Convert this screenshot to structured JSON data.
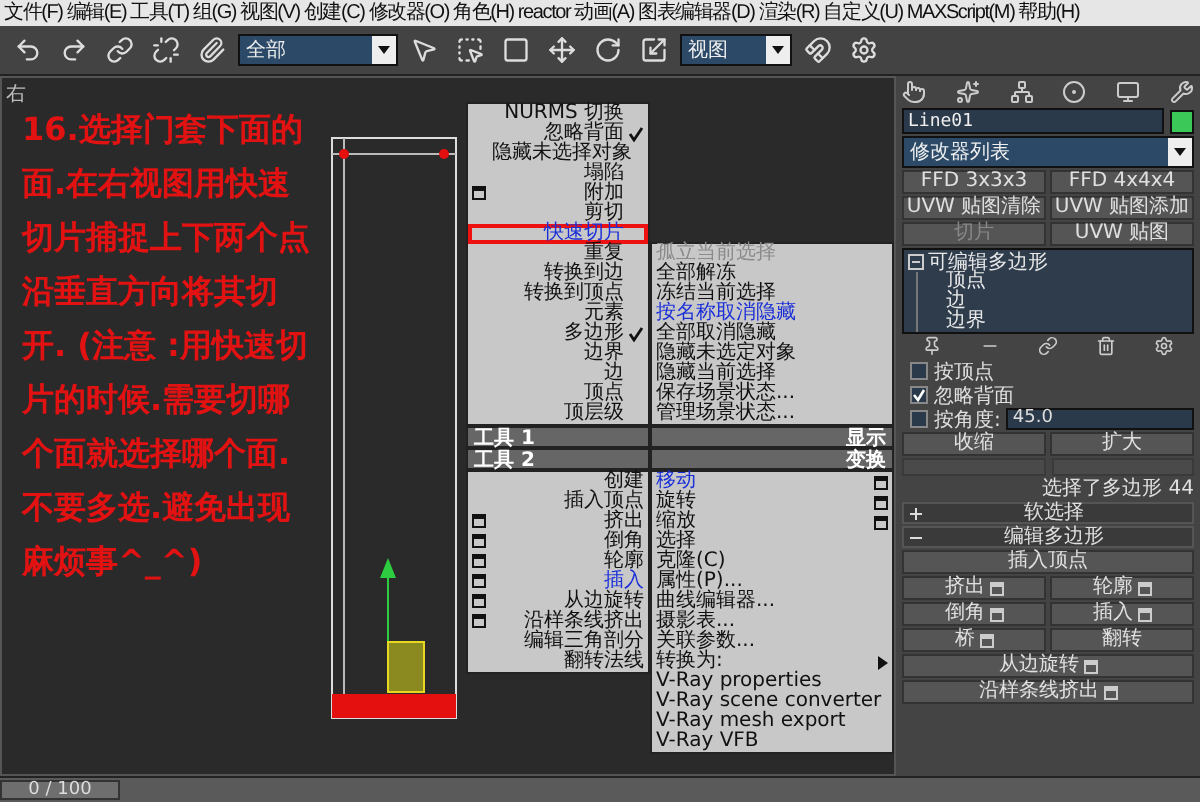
{
  "menu_bar": [
    "文件(F)",
    "编辑(E)",
    "工具(T)",
    "组(G)",
    "视图(V)",
    "创建(C)",
    "修改器(O)",
    "角色(H)",
    "reactor",
    "动画(A)",
    "图表编辑器(D)",
    "渲染(R)",
    "自定义(U)",
    "MAXScript(M)",
    "帮助(H)"
  ],
  "toolbar": {
    "selection_filter": "全部",
    "coordinate_system": "视图"
  },
  "viewport": {
    "label": "右",
    "note": "16.选择门套下面的面.在右视图用快速切片捕捉上下两个点沿垂直方向将其切开. (注意 :用快速切片的时候.需要切哪个面就选择哪个面.不要多选.避免出现麻烦事^_^)"
  },
  "quad_menu": {
    "tools_1": {
      "header": "工具 1",
      "items": [
        {
          "label": "NURMS 切换",
          "checked": false,
          "option_box": false,
          "highlighted": false,
          "annotated": false
        },
        {
          "label": "忽略背面",
          "checked": true,
          "option_box": false,
          "highlighted": false,
          "annotated": false
        },
        {
          "label": "隐藏未选择对象",
          "checked": false,
          "option_box": false,
          "highlighted": false,
          "annotated": false
        },
        {
          "label": "塌陷",
          "checked": false,
          "option_box": false,
          "highlighted": false,
          "annotated": false
        },
        {
          "label": "附加",
          "checked": false,
          "option_box": true,
          "highlighted": false,
          "annotated": false
        },
        {
          "label": "剪切",
          "checked": false,
          "option_box": false,
          "highlighted": false,
          "annotated": false
        },
        {
          "label": "快速切片",
          "checked": false,
          "option_box": false,
          "highlighted": true,
          "annotated": true
        },
        {
          "label": "重复",
          "checked": false,
          "option_box": false,
          "highlighted": false,
          "annotated": false
        },
        {
          "label": "转换到边",
          "checked": false,
          "option_box": false,
          "highlighted": false,
          "annotated": false
        },
        {
          "label": "转换到顶点",
          "checked": false,
          "option_box": false,
          "highlighted": false,
          "annotated": false
        },
        {
          "label": "元素",
          "checked": false,
          "option_box": false,
          "highlighted": false,
          "annotated": false
        },
        {
          "label": "多边形",
          "checked": true,
          "option_box": false,
          "highlighted": false,
          "annotated": false
        },
        {
          "label": "边界",
          "checked": false,
          "option_box": false,
          "highlighted": false,
          "annotated": false
        },
        {
          "label": "边",
          "checked": false,
          "option_box": false,
          "highlighted": false,
          "annotated": false
        },
        {
          "label": "顶点",
          "checked": false,
          "option_box": false,
          "highlighted": false,
          "annotated": false
        },
        {
          "label": "顶层级",
          "checked": false,
          "option_box": false,
          "highlighted": false,
          "annotated": false
        }
      ]
    },
    "display": {
      "header": "显示",
      "items": [
        {
          "label": "孤立当前选择",
          "disabled": true,
          "highlighted": false
        },
        {
          "label": "全部解冻",
          "disabled": false,
          "highlighted": false
        },
        {
          "label": "冻结当前选择",
          "disabled": false,
          "highlighted": false
        },
        {
          "label": "按名称取消隐藏",
          "disabled": false,
          "highlighted": true
        },
        {
          "label": "全部取消隐藏",
          "disabled": false,
          "highlighted": false
        },
        {
          "label": "隐藏未选定对象",
          "disabled": false,
          "highlighted": false
        },
        {
          "label": "隐藏当前选择",
          "disabled": false,
          "highlighted": false
        },
        {
          "label": "保存场景状态...",
          "disabled": false,
          "highlighted": false
        },
        {
          "label": "管理场景状态...",
          "disabled": false,
          "highlighted": false
        }
      ]
    },
    "tools_2": {
      "header": "工具 2",
      "items": [
        {
          "label": "创建",
          "option_box": false,
          "highlighted": false
        },
        {
          "label": "插入顶点",
          "option_box": false,
          "highlighted": false
        },
        {
          "label": "挤出",
          "option_box": true,
          "highlighted": false
        },
        {
          "label": "倒角",
          "option_box": true,
          "highlighted": false
        },
        {
          "label": "轮廓",
          "option_box": true,
          "highlighted": false
        },
        {
          "label": "插入",
          "option_box": true,
          "highlighted": true
        },
        {
          "label": "从边旋转",
          "option_box": true,
          "highlighted": false
        },
        {
          "label": "沿样条线挤出",
          "option_box": true,
          "highlighted": false
        },
        {
          "label": "编辑三角剖分",
          "option_box": false,
          "highlighted": false
        },
        {
          "label": "翻转法线",
          "option_box": false,
          "highlighted": false
        }
      ]
    },
    "transform": {
      "header": "变换",
      "items": [
        {
          "label": "移动",
          "option_box": true,
          "highlighted": true,
          "submenu": false
        },
        {
          "label": "旋转",
          "option_box": true,
          "highlighted": false,
          "submenu": false
        },
        {
          "label": "缩放",
          "option_box": true,
          "highlighted": false,
          "submenu": false
        },
        {
          "label": "选择",
          "option_box": false,
          "highlighted": false,
          "submenu": false
        },
        {
          "label": "克隆(C)",
          "option_box": false,
          "highlighted": false,
          "submenu": false
        },
        {
          "label": "属性(P)...",
          "option_box": false,
          "highlighted": false,
          "submenu": false
        },
        {
          "label": "曲线编辑器...",
          "option_box": false,
          "highlighted": false,
          "submenu": false
        },
        {
          "label": "摄影表...",
          "option_box": false,
          "highlighted": false,
          "submenu": false
        },
        {
          "label": "关联参数...",
          "option_box": false,
          "highlighted": false,
          "submenu": false
        },
        {
          "label": "转换为:",
          "option_box": false,
          "highlighted": false,
          "submenu": true
        },
        {
          "label": "V-Ray properties",
          "option_box": false,
          "highlighted": false,
          "submenu": false
        },
        {
          "label": "V-Ray scene converter",
          "option_box": false,
          "highlighted": false,
          "submenu": false
        },
        {
          "label": "V-Ray mesh export",
          "option_box": false,
          "highlighted": false,
          "submenu": false
        },
        {
          "label": "V-Ray VFB",
          "option_box": false,
          "highlighted": false,
          "submenu": false
        }
      ]
    }
  },
  "command_panel": {
    "object_name": "Line01",
    "modifier_list": "修改器列表",
    "modifier_buttons": [
      {
        "label": "FFD 3x3x3",
        "disabled": false
      },
      {
        "label": "FFD 4x4x4",
        "disabled": false
      },
      {
        "label": "UVW 贴图清除",
        "disabled": false
      },
      {
        "label": "UVW 贴图添加",
        "disabled": false
      },
      {
        "label": "切片",
        "disabled": true
      },
      {
        "label": "UVW 贴图",
        "disabled": false
      }
    ],
    "stack": [
      {
        "label": "可编辑多边形",
        "expanded": true,
        "children": [
          {
            "label": "顶点"
          },
          {
            "label": "边"
          },
          {
            "label": "边界"
          }
        ]
      }
    ],
    "selection": {
      "options": [
        {
          "label": "按顶点",
          "checked": false
        },
        {
          "label": "忽略背面",
          "checked": true
        },
        {
          "label": "按角度:",
          "checked": false
        }
      ],
      "angle": "45.0",
      "buttons": [
        "收缩",
        "扩大"
      ],
      "status": "选择了多边形 44"
    },
    "rollouts": [
      {
        "label": "软选择",
        "expanded": false
      },
      {
        "label": "编辑多边形",
        "expanded": true
      }
    ],
    "edit_buttons": [
      {
        "label": "插入顶点",
        "wide": true,
        "option_box": false
      },
      {
        "label": "挤出",
        "wide": false,
        "option_box": true
      },
      {
        "label": "轮廓",
        "wide": false,
        "option_box": true
      },
      {
        "label": "倒角",
        "wide": false,
        "option_box": true
      },
      {
        "label": "插入",
        "wide": false,
        "option_box": true
      },
      {
        "label": "桥",
        "wide": false,
        "option_box": true
      },
      {
        "label": "翻转",
        "wide": false,
        "option_box": false
      },
      {
        "label": "从边旋转",
        "wide": true,
        "option_box": true
      },
      {
        "label": "沿样条线挤出",
        "wide": true,
        "option_box": true
      }
    ]
  },
  "status_bar": {
    "time": "0 / 100",
    "level": 0
  }
}
